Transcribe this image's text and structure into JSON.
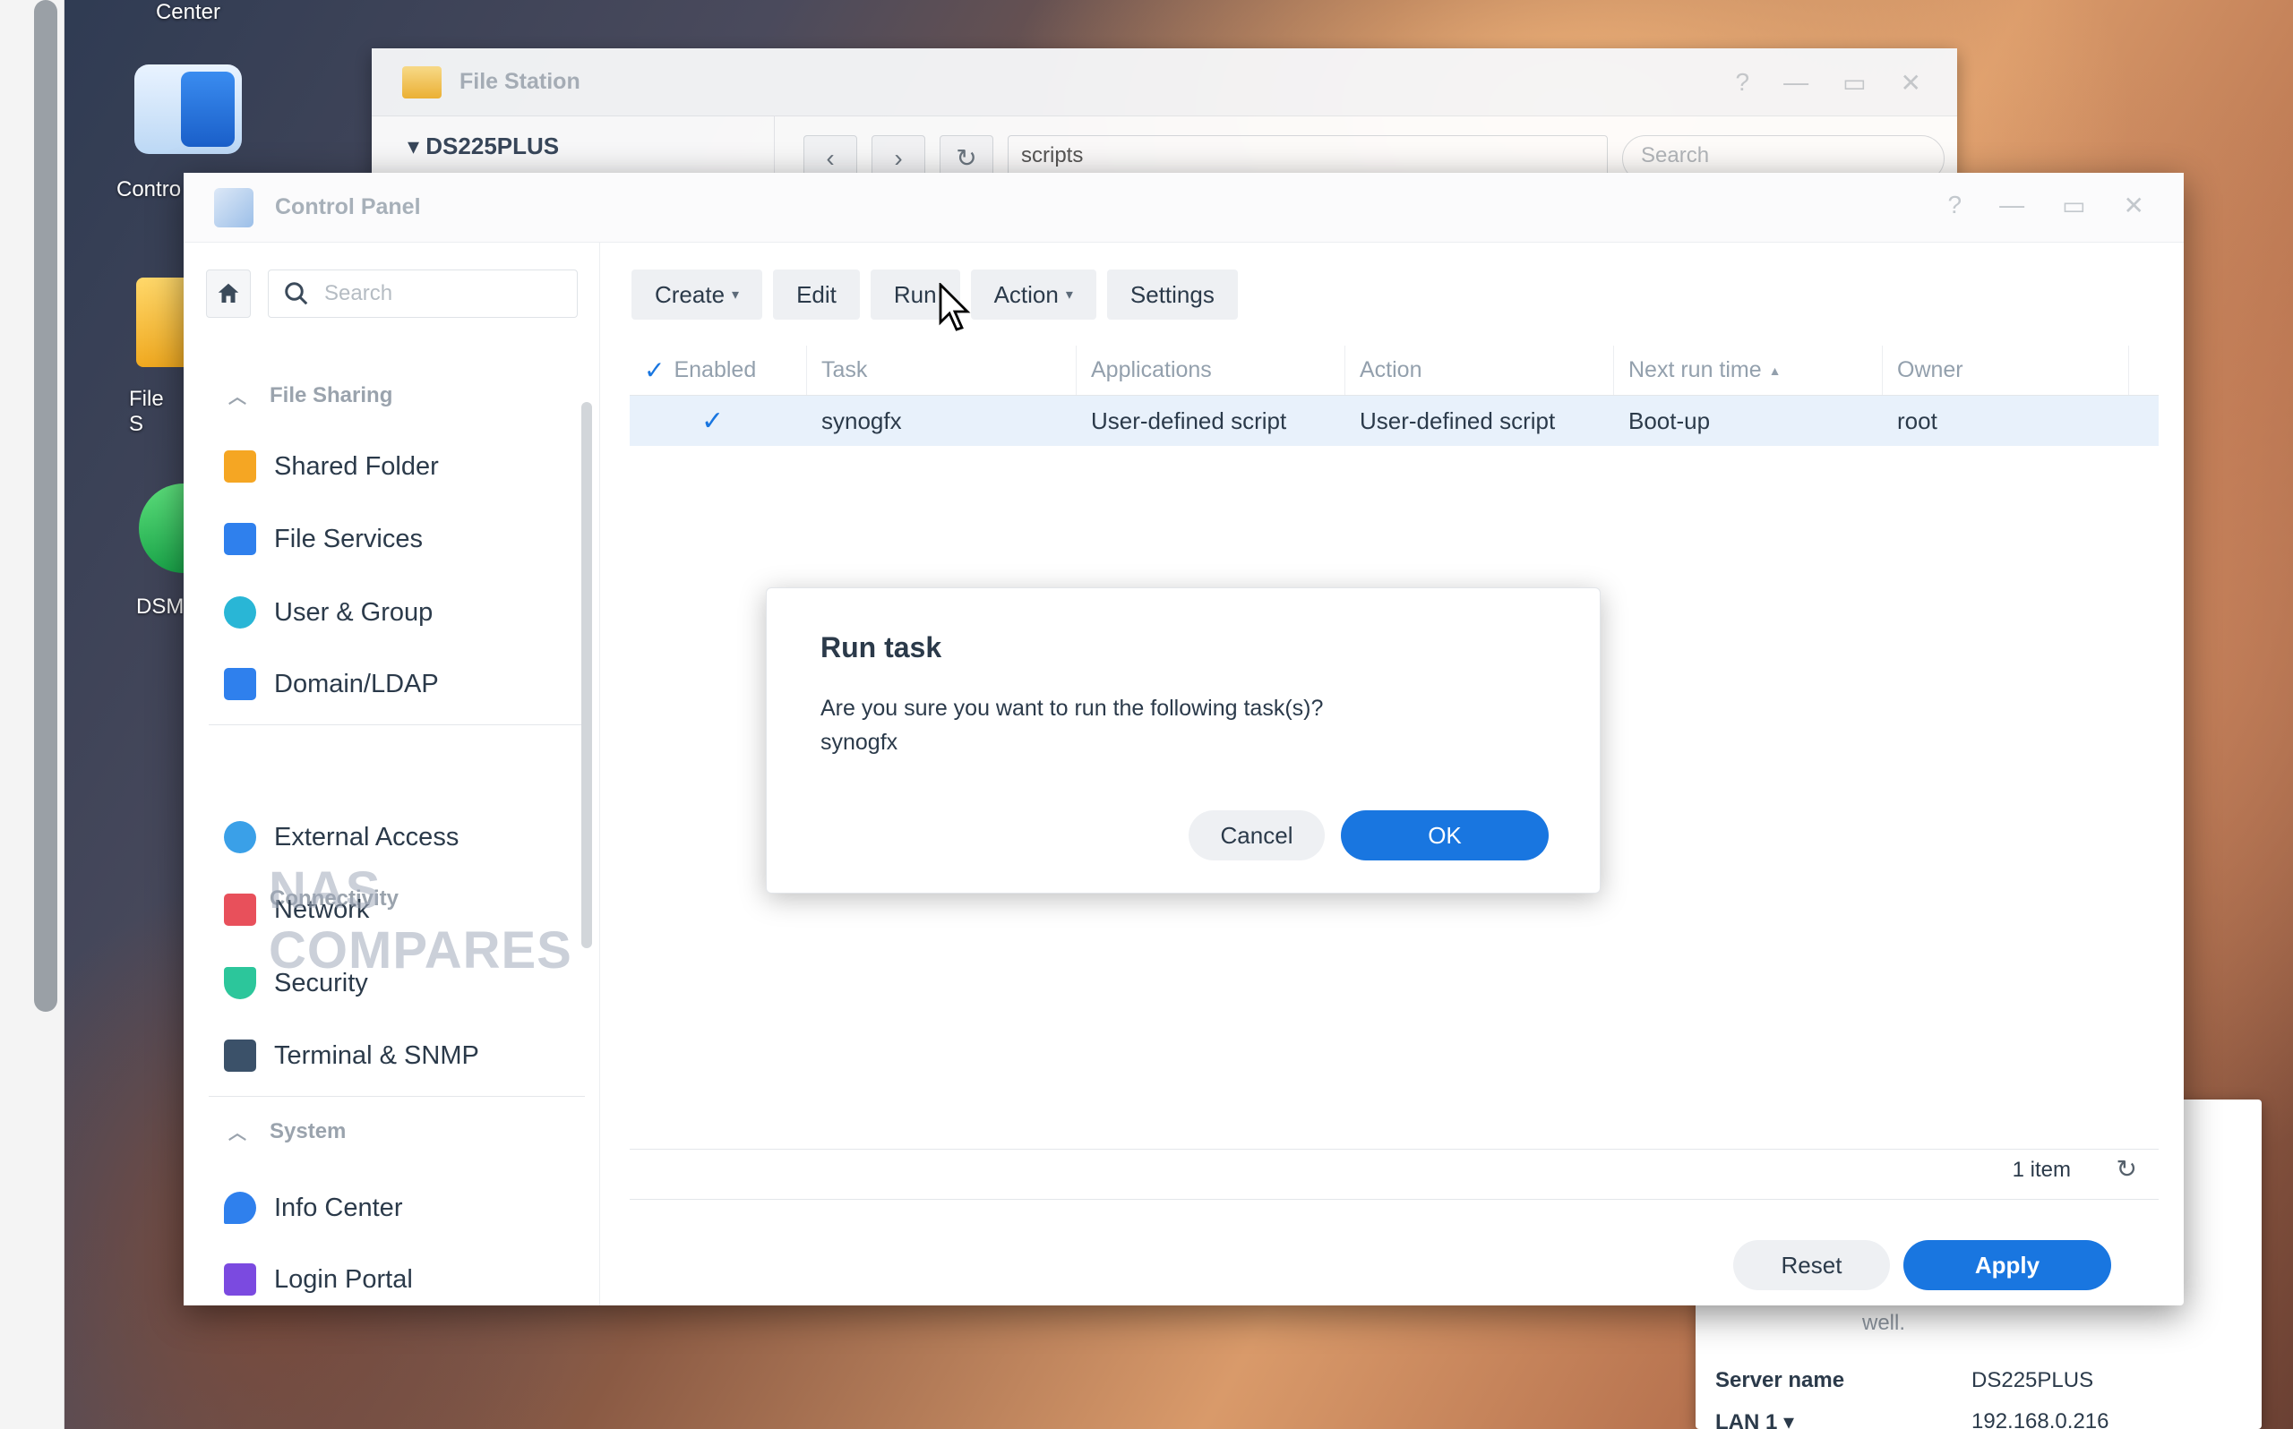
{
  "desktop": {
    "top_label": "Center",
    "icons": [
      {
        "label": "Contro"
      },
      {
        "label": "File S"
      },
      {
        "label": "DSM"
      }
    ]
  },
  "file_station": {
    "title": "File Station",
    "tree_root": "DS225PLUS",
    "path": "scripts",
    "search_placeholder": "Search"
  },
  "control_panel": {
    "title": "Control Panel",
    "search_placeholder": "Search",
    "sections": [
      {
        "label": "File Sharing"
      },
      {
        "label": "Connectivity"
      },
      {
        "label": "System"
      }
    ],
    "items": [
      {
        "label": "Shared Folder",
        "color": "#f5a623"
      },
      {
        "label": "File Services",
        "color": "#2f80ed"
      },
      {
        "label": "User & Group",
        "color": "#29b6d6"
      },
      {
        "label": "Domain/LDAP",
        "color": "#2f80ed"
      },
      {
        "label": "External Access",
        "color": "#3aa0e8"
      },
      {
        "label": "Network",
        "color": "#e8505b"
      },
      {
        "label": "Security",
        "color": "#2cc69b"
      },
      {
        "label": "Terminal & SNMP",
        "color": "#3b5169"
      },
      {
        "label": "Info Center",
        "color": "#2f80ed"
      },
      {
        "label": "Login Portal",
        "color": "#7b4ae0"
      }
    ],
    "toolbar": {
      "create": "Create",
      "edit": "Edit",
      "run": "Run",
      "action": "Action",
      "settings": "Settings"
    },
    "grid": {
      "columns": [
        "Enabled",
        "Task",
        "Applications",
        "Action",
        "Next run time",
        "Owner"
      ],
      "rows": [
        {
          "enabled": true,
          "task": "synogfx",
          "applications": "User-defined script",
          "action": "User-defined script",
          "next_run": "Boot-up",
          "owner": "root"
        }
      ],
      "count": "1 item"
    },
    "footer": {
      "reset": "Reset",
      "apply": "Apply"
    }
  },
  "dialog": {
    "title": "Run task",
    "message": "Are you sure you want to run the following task(s)?",
    "task": "synogfx",
    "cancel": "Cancel",
    "ok": "OK"
  },
  "watermark": "NAS COMPARES",
  "widget": {
    "status_text": "well.",
    "server_name_label": "Server name",
    "server_name_value": "DS225PLUS",
    "lan_label": "LAN 1",
    "lan_value": "192.168.0.216"
  },
  "colors": {
    "accent": "#1976e0",
    "selected_row": "#e8f1fb",
    "status_green": "#19c33a"
  }
}
